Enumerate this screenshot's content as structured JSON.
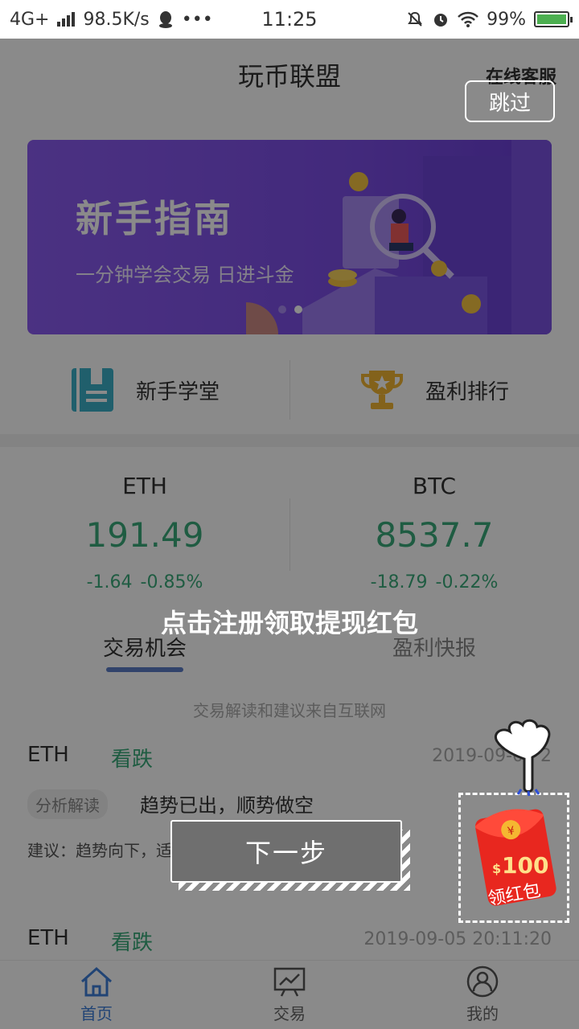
{
  "status": {
    "network": "4G+",
    "speed": "98.5K/s",
    "more": "•••",
    "time": "11:25",
    "battery": "99%",
    "battery_level": 0.99
  },
  "header": {
    "title": "玩币联盟",
    "service": "在线客服"
  },
  "banner": {
    "title": "新手指南",
    "subtitle": "一分钟学会交易  日进斗金"
  },
  "quick": {
    "school": "新手学堂",
    "ranking": "盈利排行"
  },
  "prices": [
    {
      "name": "ETH",
      "value": "191.49",
      "change": "-1.64",
      "percent": "-0.85%"
    },
    {
      "name": "BTC",
      "value": "8537.7",
      "change": "-18.79",
      "percent": "-0.22%"
    }
  ],
  "tabs": {
    "opportunities": "交易机会",
    "profit_news": "盈利快报"
  },
  "note": "交易解读和建议来自互联网",
  "feed": [
    {
      "coin": "ETH",
      "signal": "看跌",
      "time": "2019-09-05 2",
      "tag": "分析解读",
      "headline": "趋势已出，顺势做空",
      "advice": "建议：趋势向下，适当建立空仓，做好止损"
    },
    {
      "coin": "ETH",
      "signal": "看跌",
      "time": "2019-09-05 20:11:20"
    }
  ],
  "nav": {
    "home": "首页",
    "trade": "交易",
    "mine": "我的"
  },
  "overlay": {
    "skip": "跳过",
    "guide": "点击注册领取提现红包",
    "next": "下一步",
    "envelope_amount": "100",
    "envelope_currency": "$",
    "envelope_label": "领红包"
  }
}
